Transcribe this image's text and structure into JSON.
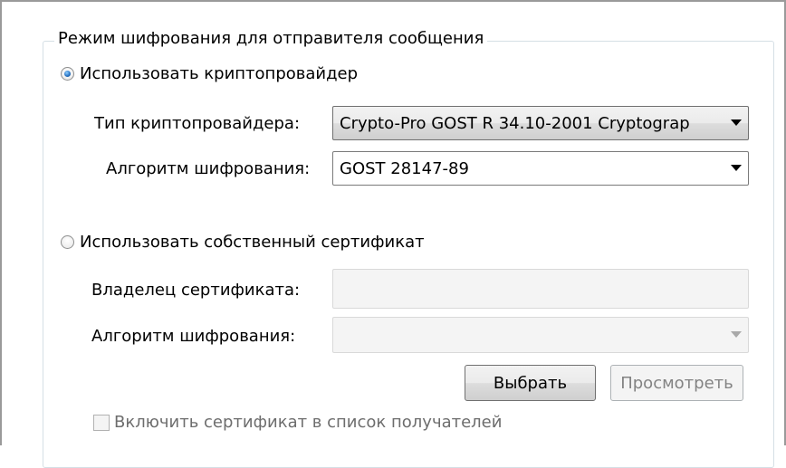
{
  "group": {
    "title": "Режим шифрования для отправителя сообщения"
  },
  "crypto_provider": {
    "radio_label": "Использовать криптопровайдер",
    "selected": true,
    "type_label": "Тип криптопровайдера:",
    "type_value": "Crypto-Pro GOST R 34.10-2001 Cryptograp",
    "algorithm_label": "Алгоритм шифрования:",
    "algorithm_value": "GOST 28147-89"
  },
  "own_certificate": {
    "radio_label": "Использовать собственный сертификат",
    "selected": false,
    "owner_label": "Владелец сертификата:",
    "owner_value": "",
    "algorithm_label": "Алгоритм шифрования:",
    "algorithm_value": "",
    "select_button": "Выбрать",
    "view_button": "Просмотреть",
    "include_checkbox_label": "Включить сертификат в список получателей",
    "include_checked": false
  },
  "icons": {
    "dropdown": "chevron-down-icon"
  }
}
